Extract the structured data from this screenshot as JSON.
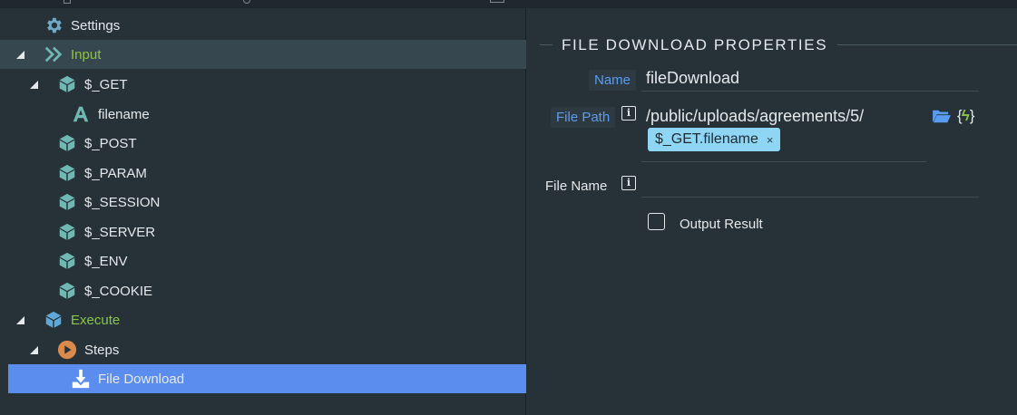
{
  "tree": {
    "items": [
      {
        "label": "Settings",
        "icon": "gear-icon"
      },
      {
        "label": "Input",
        "icon": "chevrons-right-icon"
      },
      {
        "label": "$_GET",
        "icon": "cube-icon"
      },
      {
        "label": "filename",
        "icon": "text-a-icon"
      },
      {
        "label": "$_POST",
        "icon": "cube-icon"
      },
      {
        "label": "$_PARAM",
        "icon": "cube-icon"
      },
      {
        "label": "$_SESSION",
        "icon": "cube-icon"
      },
      {
        "label": "$_SERVER",
        "icon": "cube-icon"
      },
      {
        "label": "$_ENV",
        "icon": "cube-icon"
      },
      {
        "label": "$_COOKIE",
        "icon": "cube-icon"
      },
      {
        "label": "Execute",
        "icon": "cube-icon"
      },
      {
        "label": "Steps",
        "icon": "play-circle-icon"
      },
      {
        "label": "File Download",
        "icon": "download-icon"
      }
    ]
  },
  "properties": {
    "title": "FILE DOWNLOAD PROPERTIES",
    "name_label": "Name",
    "name_value": "fileDownload",
    "filepath_label": "File Path",
    "filepath_value": "/public/uploads/agreements/5/",
    "filepath_token": "$_GET.filename",
    "filepath_token_remove": "×",
    "filename_label": "File Name",
    "filename_value": "",
    "output_label": "Output Result",
    "dynamic_icon_text": "{ϟ}"
  },
  "colors": {
    "accent_blue": "#5a8dee",
    "label_blue": "#5a9cf0",
    "green": "#8bc34a",
    "cube_teal": "#6fb8b4",
    "token_bg": "#8fd6f5"
  }
}
